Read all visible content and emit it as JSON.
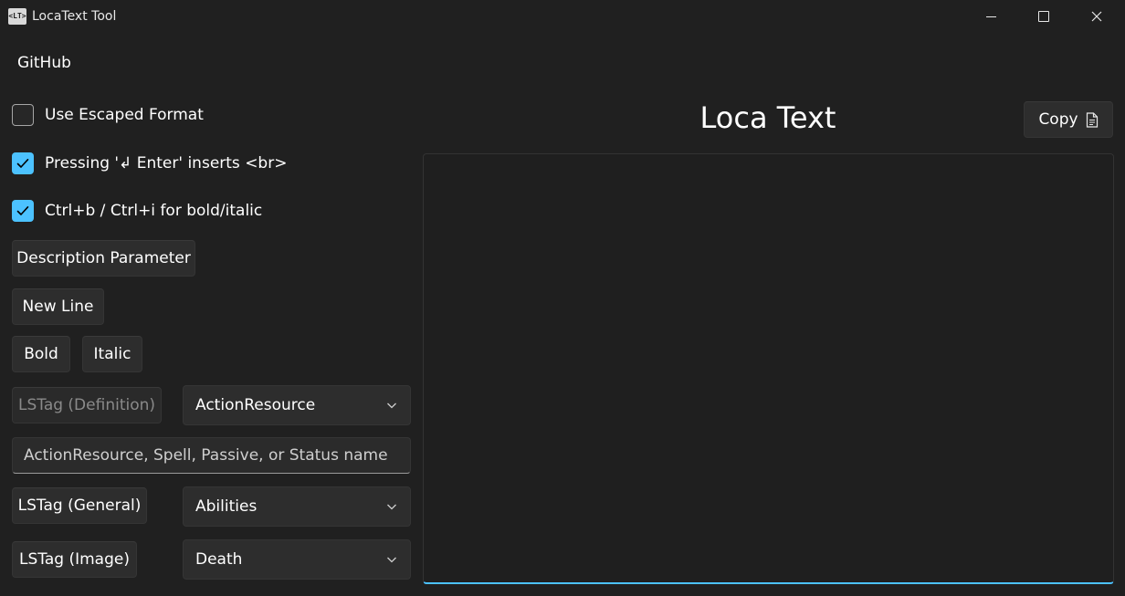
{
  "window": {
    "title": "LocaText Tool",
    "icon": "app-logo-icon",
    "icon_text": "<LT>"
  },
  "menu": {
    "github": "GitHub"
  },
  "options": {
    "escaped": {
      "label": "Use Escaped Format",
      "checked": false
    },
    "enter_br": {
      "label": "Pressing '↲ Enter' inserts <br>",
      "checked": true
    },
    "bold_italic": {
      "label": "Ctrl+b / Ctrl+i for bold/italic",
      "checked": true
    }
  },
  "buttons": {
    "description_parameter": "Description Parameter",
    "new_line": "New Line",
    "bold": "Bold",
    "italic": "Italic",
    "lstag_definition": "LSTag (Definition)",
    "lstag_general": "LSTag (General)",
    "lstag_image": "LSTag (Image)"
  },
  "combos": {
    "definition": "ActionResource",
    "general": "Abilities",
    "image": "Death"
  },
  "name_input": {
    "placeholder": "ActionResource, Spell, Passive, or Status name",
    "value": ""
  },
  "editor": {
    "title": "Loca Text",
    "copy_label": "Copy",
    "content": ""
  },
  "colors": {
    "accent": "#4cc2ff",
    "background": "#202020",
    "control": "#2d2d2d"
  }
}
